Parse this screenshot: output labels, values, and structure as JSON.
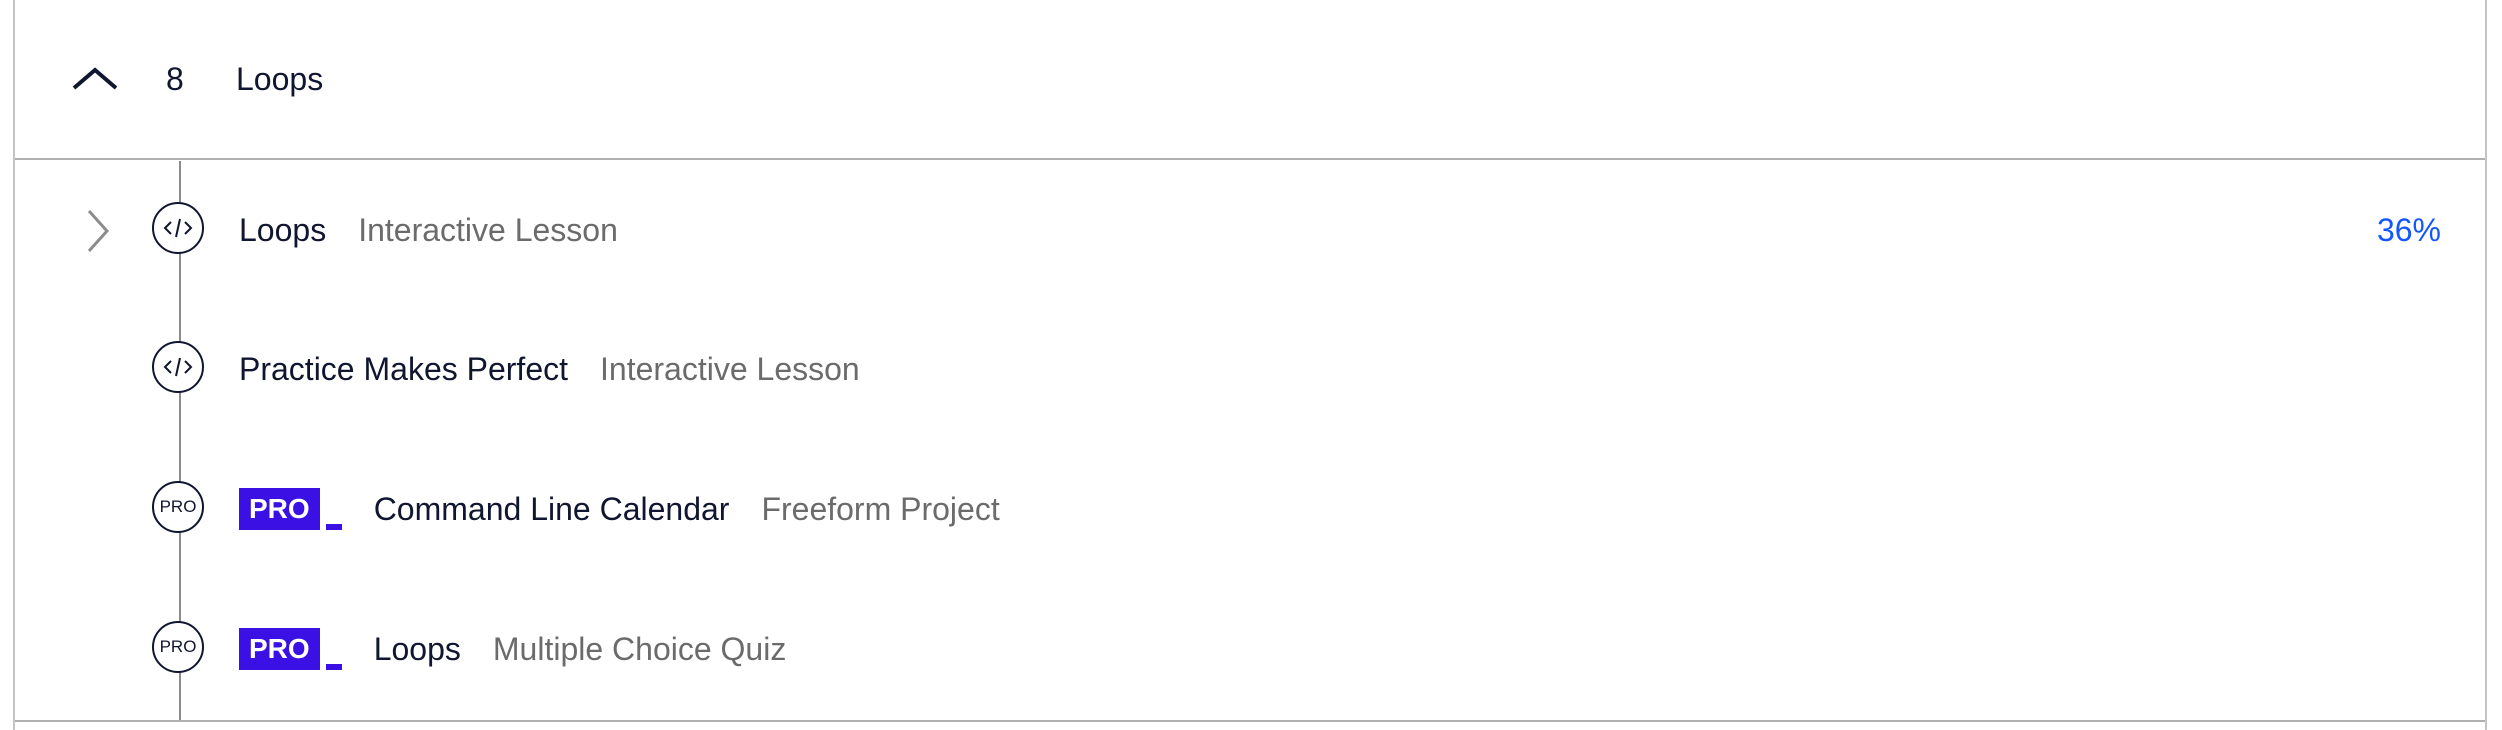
{
  "module": {
    "number": "8",
    "title": "Loops"
  },
  "items": [
    {
      "title": "Loops",
      "type": "Interactive Lesson",
      "progress": "36%",
      "icon": "code-icon",
      "pro": false
    },
    {
      "title": "Practice Makes Perfect",
      "type": "Interactive Lesson",
      "icon": "code-icon",
      "pro": false
    },
    {
      "title": "Command Line Calendar",
      "type": "Freeform Project",
      "icon": "pro-icon",
      "node_label": "PRO",
      "badge": "PRO",
      "pro": true
    },
    {
      "title": "Loops",
      "type": "Multiple Choice Quiz",
      "icon": "pro-icon",
      "node_label": "PRO",
      "badge": "PRO",
      "pro": true
    }
  ],
  "colors": {
    "text": "#10162f",
    "muted": "#6b6b6b",
    "progress": "#1557ff",
    "pro_badge": "#3a10e5",
    "border": "#c4c4c4"
  }
}
